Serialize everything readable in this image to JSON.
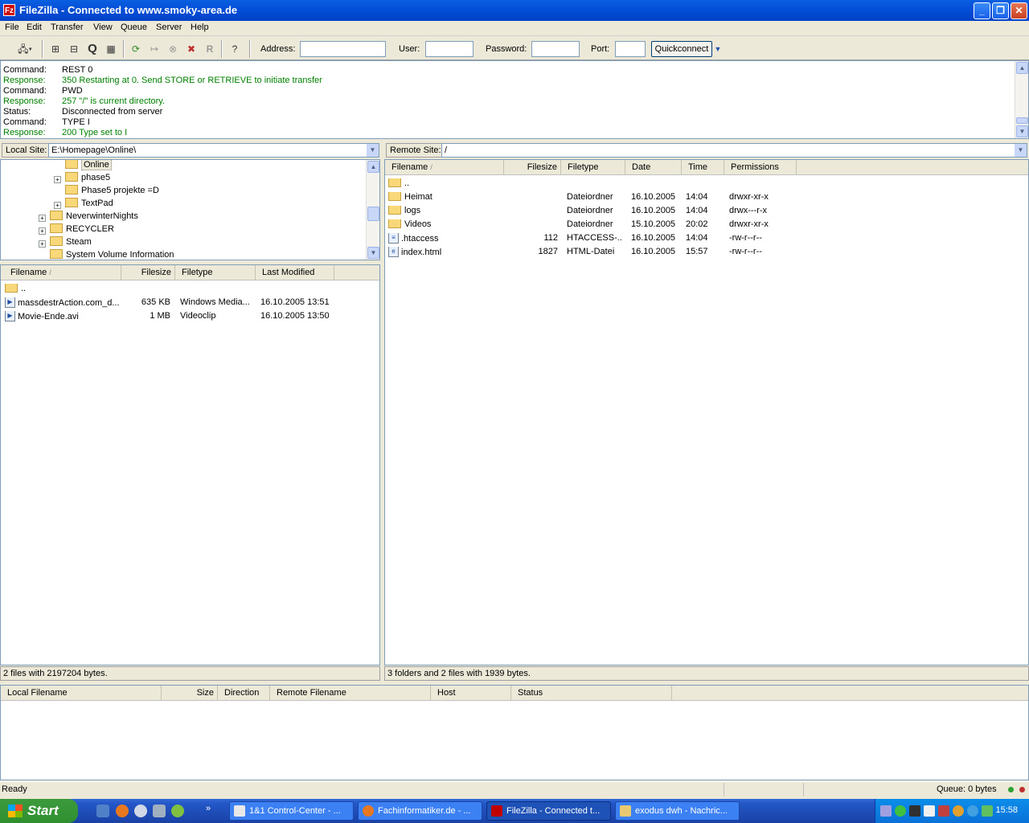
{
  "window": {
    "title": "FileZilla - Connected to www.smoky-area.de",
    "icon_text": "Fz"
  },
  "menu": [
    "File",
    "Edit",
    "Transfer",
    "View",
    "Queue",
    "Server",
    "Help"
  ],
  "quickconnect": {
    "address_label": "Address:",
    "address_value": "",
    "user_label": "User:",
    "user_value": "",
    "password_label": "Password:",
    "password_value": "",
    "port_label": "Port:",
    "port_value": "",
    "button": "Quickconnect"
  },
  "log": [
    {
      "type": "Command:",
      "text": "REST 0",
      "color": "#000000"
    },
    {
      "type": "Response:",
      "text": "350 Restarting at 0. Send STORE or RETRIEVE to initiate transfer",
      "color": "#008000"
    },
    {
      "type": "Command:",
      "text": "PWD",
      "color": "#000000"
    },
    {
      "type": "Response:",
      "text": "257 \"/\" is current directory.",
      "color": "#008000"
    },
    {
      "type": "Status:",
      "text": "Disconnected from server",
      "color": "#000000"
    },
    {
      "type": "Command:",
      "text": "TYPE I",
      "color": "#000000"
    },
    {
      "type": "Response:",
      "text": "200 Type set to I",
      "color": "#008000"
    }
  ],
  "local": {
    "label": "Local Site:",
    "path": "E:\\Homepage\\Online\\",
    "tree": [
      {
        "name": "Online",
        "selected": true
      },
      {
        "name": "phase5"
      },
      {
        "name": "Phase5 projekte =D"
      },
      {
        "name": "TextPad"
      },
      {
        "name": "NeverwinterNights"
      },
      {
        "name": "RECYCLER"
      },
      {
        "name": "Steam"
      },
      {
        "name": "System Volume Information"
      }
    ],
    "columns": [
      "Filename",
      "Filesize",
      "Filetype",
      "Last Modified"
    ],
    "files": [
      {
        "name": "..",
        "size": "",
        "type": "",
        "modified": ""
      },
      {
        "name": "massdestrAction.com_d...",
        "size": "635 KB",
        "type": "Windows Media...",
        "modified": "16.10.2005 13:51"
      },
      {
        "name": "Movie-Ende.avi",
        "size": "1 MB",
        "type": "Videoclip",
        "modified": "16.10.2005 13:50"
      }
    ],
    "status": "2 files with 2197204 bytes."
  },
  "remote": {
    "label": "Remote Site:",
    "path": "/",
    "columns": [
      "Filename",
      "Filesize",
      "Filetype",
      "Date",
      "Time",
      "Permissions"
    ],
    "files": [
      {
        "name": "..",
        "size": "",
        "type": "",
        "date": "",
        "time": "",
        "perm": ""
      },
      {
        "name": "Heimat",
        "size": "",
        "type": "Dateiordner",
        "date": "16.10.2005",
        "time": "14:04",
        "perm": "drwxr-xr-x"
      },
      {
        "name": "logs",
        "size": "",
        "type": "Dateiordner",
        "date": "16.10.2005",
        "time": "14:04",
        "perm": "drwx---r-x"
      },
      {
        "name": "Videos",
        "size": "",
        "type": "Dateiordner",
        "date": "15.10.2005",
        "time": "20:02",
        "perm": "drwxr-xr-x"
      },
      {
        "name": ".htaccess",
        "size": "112",
        "type": "HTACCESS-...",
        "date": "16.10.2005",
        "time": "14:04",
        "perm": "-rw-r--r--"
      },
      {
        "name": "index.html",
        "size": "1827",
        "type": "HTML-Datei",
        "date": "16.10.2005",
        "time": "15:57",
        "perm": "-rw-r--r--"
      }
    ],
    "status": "3 folders and 2 files with 1939 bytes."
  },
  "queue": {
    "columns": [
      "Local Filename",
      "Size",
      "Direction",
      "Remote Filename",
      "Host",
      "Status"
    ]
  },
  "statusbar": {
    "left": "Ready",
    "queue": "Queue: 0 bytes"
  },
  "taskbar": {
    "start": "Start",
    "tasks": [
      {
        "label": "1&1 Control-Center - ...",
        "color": "#e8e8e8"
      },
      {
        "label": "Fachinformatiker.de - ...",
        "color": "#e87820"
      },
      {
        "label": "FileZilla - Connected t...",
        "color": "#c00000",
        "active": true
      },
      {
        "label": "exodus dwh - Nachric...",
        "color": "#e8c870"
      }
    ],
    "clock": "15:58"
  }
}
